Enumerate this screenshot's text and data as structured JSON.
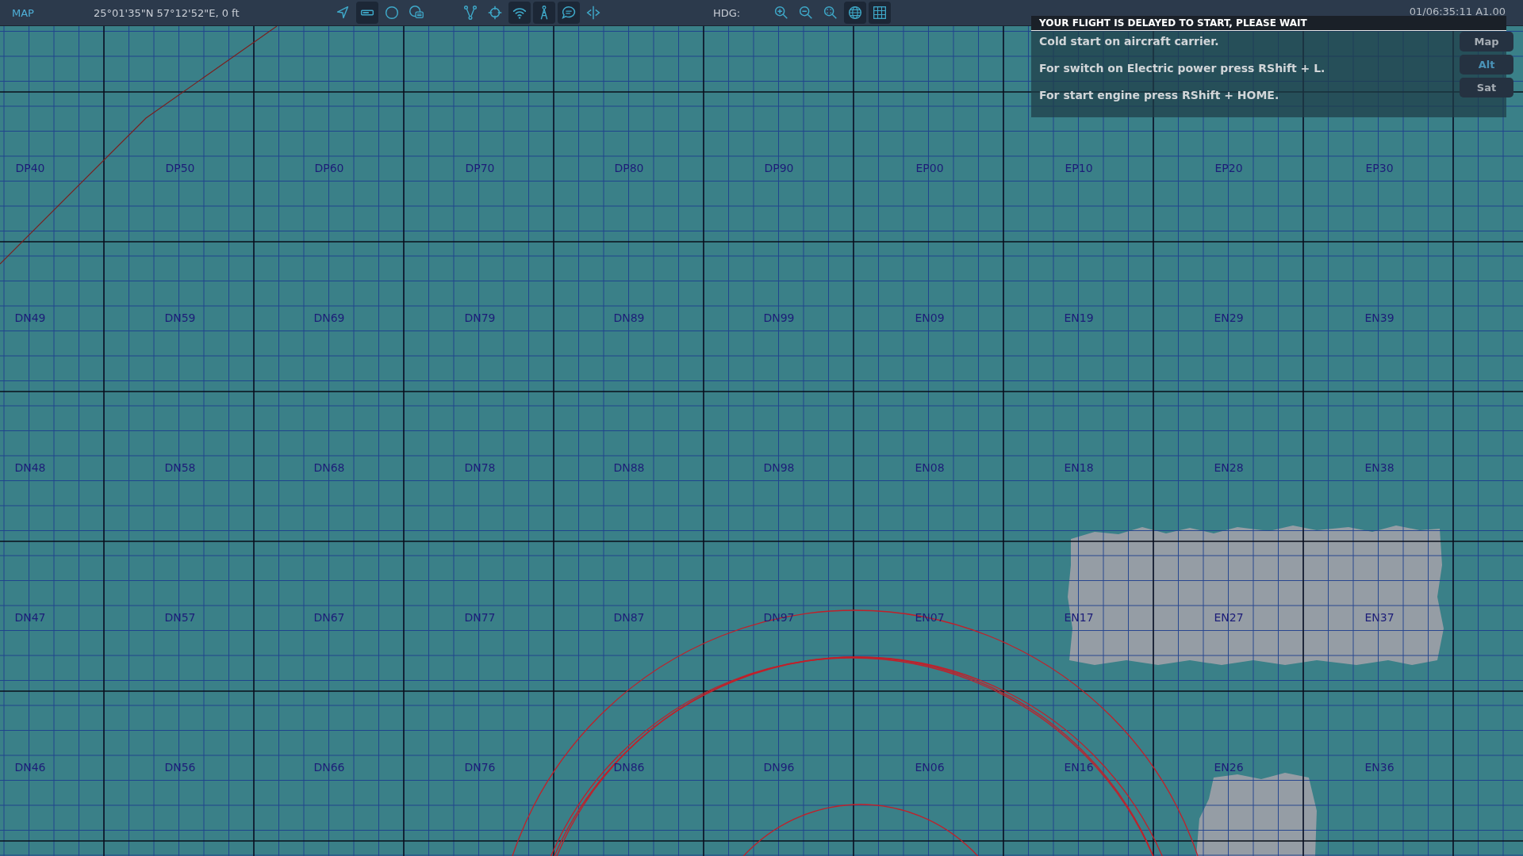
{
  "top_bar": {
    "title": "MAP",
    "coordinates": "25°01'35\"N 57°12'52\"E, 0 ft",
    "tools": [
      {
        "selected": false
      },
      {
        "selected": true
      },
      {
        "selected": false
      },
      {
        "selected": false
      }
    ],
    "tools_2": [
      {
        "selected": false
      },
      {
        "selected": false
      },
      {
        "selected": true
      },
      {
        "selected": true
      },
      {
        "selected": true
      },
      {
        "selected": false
      }
    ],
    "heading_label": "HDG:",
    "view_tools": [
      {
        "selected": false
      },
      {
        "selected": false
      },
      {
        "selected": false
      },
      {
        "selected": true
      },
      {
        "selected": true
      }
    ],
    "time": "01/06:35:11 A1.00"
  },
  "map": {
    "grid_rows": [
      [
        "DP40",
        "DP50",
        "DP60",
        "DP70",
        "DP80",
        "DP90",
        "EP00",
        "EP10",
        "EP20",
        "EP30"
      ],
      [
        "DN49",
        "DN59",
        "DN69",
        "DN79",
        "DN89",
        "DN99",
        "EN09",
        "EN19",
        "EN29",
        "EN39"
      ],
      [
        "DN48",
        "DN58",
        "DN68",
        "DN78",
        "DN88",
        "DN98",
        "EN08",
        "EN18",
        "EN28",
        "EN38"
      ],
      [
        "DN47",
        "DN57",
        "DN67",
        "DN77",
        "DN87",
        "DN97",
        "EN07",
        "EN17",
        "EN27",
        "EN37"
      ],
      [
        "DN46",
        "DN56",
        "DN66",
        "DN76",
        "DN86",
        "DN96",
        "EN06",
        "EN16",
        "EN26",
        "EN36"
      ]
    ]
  },
  "message_panel": {
    "title": "YOUR FLIGHT IS DELAYED TO START, PLEASE WAIT",
    "lines": [
      "Cold start on aircraft carrier.",
      "For switch on Electric power press RShift + L.",
      "For start engine press RShift + HOME."
    ]
  },
  "map_layers": [
    {
      "label": "Map",
      "selected": false
    },
    {
      "label": "Alt",
      "selected": true
    },
    {
      "label": "Sat",
      "selected": false
    }
  ]
}
